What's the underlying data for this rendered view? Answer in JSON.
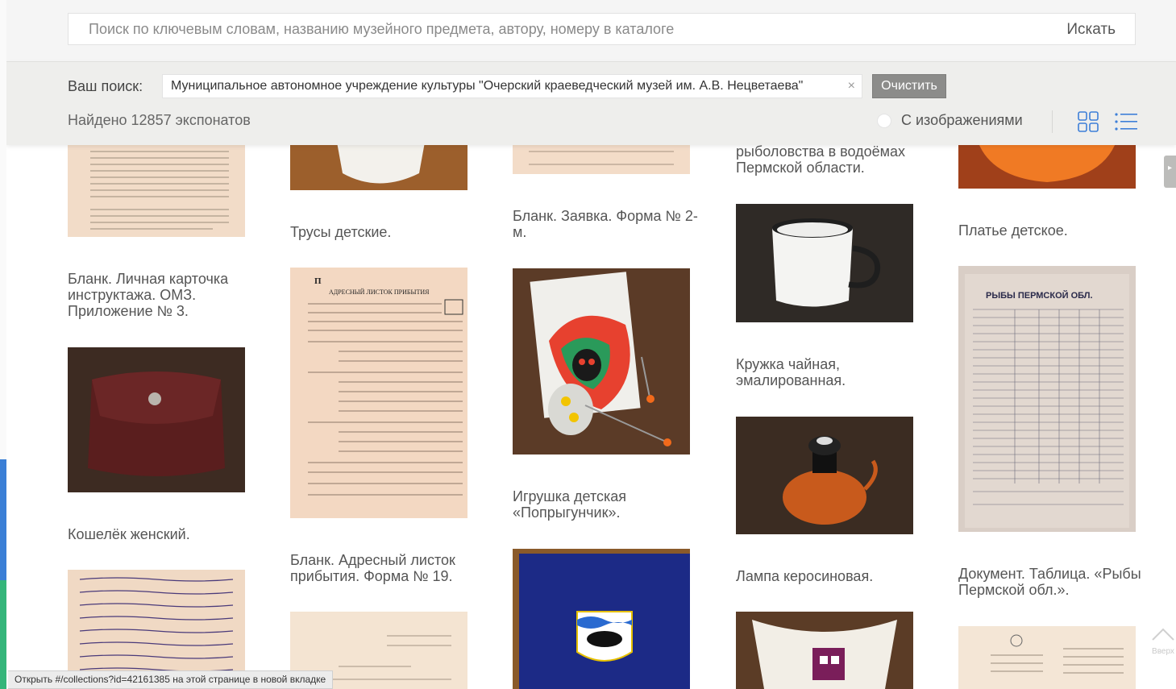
{
  "search": {
    "placeholder": "Поиск по ключевым словам, названию музейного предмета, автору, номеру в каталоге",
    "button_label": "Искать"
  },
  "filter": {
    "your_search_label": "Ваш поиск:",
    "chip_text": "Муниципальное автономное учреждение культуры \"Очерский краеведческий музей им. А.В. Нецветаева\"",
    "chip_close": "×",
    "clear_label": "Очистить",
    "found_text": "Найдено 12857 экспонатов",
    "with_images_label": "С изображениями",
    "with_images_checked": false,
    "view_mode": "grid"
  },
  "cards": [
    {
      "title": "Бланк. Личная карточка инструктажа. ОМЗ. Приложение № 3."
    },
    {
      "title": "Кошелёк женский."
    },
    {
      "title": "Трусы детские."
    },
    {
      "title": "Бланк. Адресный листок прибытия. Форма № 19."
    },
    {
      "title": "Бланк. Заявка. Форма № 2-м."
    },
    {
      "title": "Игрушка детская «Попрыгунчик»."
    },
    {
      "title": "рыболовства в водоёмах Пермской области."
    },
    {
      "title": "Кружка чайная, эмалированная."
    },
    {
      "title": "Лампа керосиновая."
    },
    {
      "title": "Платье детское."
    },
    {
      "title": "Документ. Таблица. «Рыбы Пермской обл.»."
    }
  ],
  "thumb_texts": {
    "form19_title": "АДРЕСНЫЙ ЛИСТОК ПРИБЫТИЯ",
    "fish_table_title": "РЫБЫ ПЕРМСКОЙ ОБЛ."
  },
  "to_top_label": "Вверх",
  "status_bar": "Открыть #/collections?id=42161385 на этой странице в новой вкладке",
  "colors": {
    "clear_button": "#8c8c8a",
    "accent_blue": "#3b7fd6",
    "accent_green": "#35b57a",
    "view_icon": "#3d7fd8"
  }
}
